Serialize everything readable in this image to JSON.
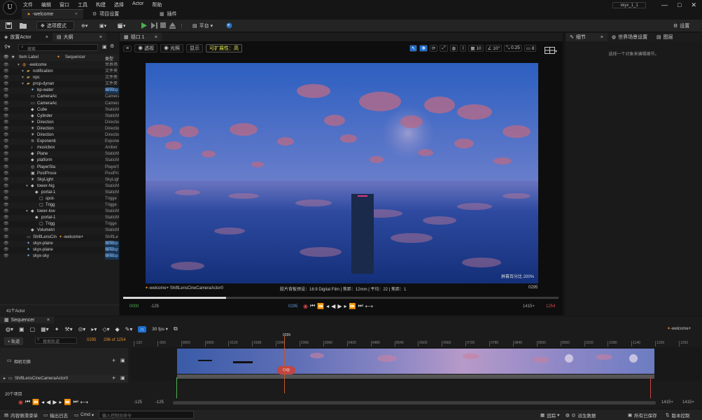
{
  "menubar": {
    "logo": "U",
    "items": [
      "文件",
      "编辑",
      "窗口",
      "工具",
      "构建",
      "选择",
      "Actor",
      "帮助"
    ],
    "window_title": "xkyx_1_1",
    "window_buttons": [
      "—",
      "□",
      "✕"
    ]
  },
  "tabs": {
    "doc": "-welcome",
    "project_settings": "项目设置",
    "plugins": "插件"
  },
  "toolbar": {
    "save_icon": "save-icon",
    "mode": "选项模式",
    "platform": "平台",
    "settings": "设置"
  },
  "outliner": {
    "tab_place": "放置Actor",
    "tab_outliner": "大纲",
    "search_placeholder": "搜索",
    "col_label": "Item Label",
    "col_sequencer": "Sequencer",
    "col_type": "类型",
    "items": [
      {
        "name": "-welcome",
        "type": "世界场",
        "indent": 0,
        "icon": "world"
      },
      {
        "name": "notification",
        "type": "文件夹",
        "indent": 1,
        "icon": "folder"
      },
      {
        "name": "npc",
        "type": "文件夹",
        "indent": 1,
        "icon": "folder"
      },
      {
        "name": "prop-dynan",
        "type": "文件夹",
        "indent": 1,
        "icon": "folder"
      },
      {
        "name": "bp-water",
        "type": "编辑bp",
        "indent": 2,
        "icon": "actor",
        "hl": true
      },
      {
        "name": "CameraAc",
        "type": "Camera",
        "indent": 2,
        "icon": "camera"
      },
      {
        "name": "CameraAc",
        "type": "Camera",
        "indent": 2,
        "icon": "camera"
      },
      {
        "name": "Cube",
        "type": "StaticM",
        "indent": 2,
        "icon": "mesh"
      },
      {
        "name": "Cylinder",
        "type": "StaticM",
        "indent": 2,
        "icon": "mesh"
      },
      {
        "name": "Direction",
        "type": "Direction",
        "indent": 2,
        "icon": "light"
      },
      {
        "name": "Direction",
        "type": "Direction",
        "indent": 2,
        "icon": "light"
      },
      {
        "name": "Direction",
        "type": "Direction",
        "indent": 2,
        "icon": "light"
      },
      {
        "name": "Exponenti",
        "type": "Expone",
        "indent": 2,
        "icon": "fog"
      },
      {
        "name": "musicbox",
        "type": "Amber",
        "indent": 2,
        "icon": "sound"
      },
      {
        "name": "Plane",
        "type": "StaticM",
        "indent": 2,
        "icon": "mesh"
      },
      {
        "name": "platform",
        "type": "StaticM",
        "indent": 2,
        "icon": "mesh"
      },
      {
        "name": "PlayerSta",
        "type": "PlayerS",
        "indent": 2,
        "icon": "player"
      },
      {
        "name": "PostProce",
        "type": "PostPro",
        "indent": 2,
        "icon": "post"
      },
      {
        "name": "SkyLight",
        "type": "SkyLigh",
        "indent": 2,
        "icon": "light"
      },
      {
        "name": "tower-hig",
        "type": "StaticM",
        "indent": 2,
        "icon": "mesh"
      },
      {
        "name": "portal-1",
        "type": "StaticM",
        "indent": 3,
        "icon": "mesh"
      },
      {
        "name": "spot-",
        "type": "Trigge",
        "indent": 4,
        "icon": "trigger"
      },
      {
        "name": "Trigg",
        "type": "Trigge",
        "indent": 4,
        "icon": "trigger"
      },
      {
        "name": "tower-low",
        "type": "StaticM",
        "indent": 2,
        "icon": "mesh"
      },
      {
        "name": "portal-1",
        "type": "StaticM",
        "indent": 3,
        "icon": "mesh"
      },
      {
        "name": "Trigg",
        "type": "Trigge",
        "indent": 4,
        "icon": "trigger"
      },
      {
        "name": "Volumetri",
        "type": "StaticM",
        "indent": 2,
        "icon": "mesh"
      },
      {
        "name": "ShiftLensCin",
        "type": "ShiftLe",
        "indent": 1,
        "icon": "camera",
        "seq": "-welcome+"
      },
      {
        "name": "skyx-plane",
        "type": "编辑bp",
        "indent": 1,
        "icon": "actor",
        "hl": true
      },
      {
        "name": "skyx-plane",
        "type": "编辑bp",
        "indent": 1,
        "icon": "actor",
        "hl": true
      },
      {
        "name": "skyx-sky",
        "type": "编辑bp",
        "indent": 1,
        "icon": "actor",
        "hl": true
      }
    ],
    "count": "41个Actor"
  },
  "viewport": {
    "tab": "视口 1",
    "btn_perspective": "透视",
    "btn_lit": "光照",
    "btn_show": "显示",
    "btn_scalability": "可扩展性：高",
    "snap_angle": "10",
    "snap_rot": "10°",
    "snap_scale": "0.25",
    "cam_speed": "8",
    "screen_percentage": "屏幕百分比 200%",
    "cam_name": "-welcome+ ShiftLensCineCameraActor0",
    "film_info": "胶片背板预设：16:9 Digital Film | 焦距：12mm | 平均：22 | 焦距：1",
    "frame_right": "0295",
    "start_frame": "0000",
    "start_minus": "-125",
    "current": "0295",
    "end_plus": "1415+",
    "end_frame": "1254",
    "play_progress": 0.236
  },
  "details": {
    "tab_details": "细节",
    "tab_world": "世界场景设置",
    "tab_layers": "图层",
    "empty": "选择一个对象来编辑细节。"
  },
  "sequencer": {
    "tab": "Sequencer",
    "fps": "30 fps",
    "seq_name": "-welcome+",
    "add_track": "+ 轨道",
    "search_placeholder": "搜索轨道",
    "current_frame": "0295",
    "frame_counter": "296 of 1254",
    "playhead_label": "0295",
    "ruler": [
      "-120",
      "-060",
      "0000",
      "0060",
      "0120",
      "0180",
      "0240",
      "0300",
      "0360",
      "0420",
      "0480",
      "0540",
      "0600",
      "0660",
      "0720",
      "0780",
      "0840",
      "0900",
      "0960",
      "1020",
      "1080",
      "1140",
      "1200",
      "1260"
    ],
    "track_camera_cut": "相机切换",
    "track_camera_actor": "ShiftLensCineCameraActor0",
    "items_count": "20个项目",
    "left_minus": "-125",
    "left_minus2": "-125",
    "right_plus": "1415+",
    "right_plus2": "1415+"
  },
  "statusbar": {
    "content_drawer": "内容侧滑菜单",
    "output_log": "输出日志",
    "cmd": "Cmd",
    "cmd_placeholder": "输入控制台命令",
    "trace": "追踪",
    "derived_data": "派生数据",
    "save_all": "所有已保存",
    "source_control": "版本控制"
  },
  "colors": {
    "accent_green": "#4caf50",
    "select_blue": "#1f6fd1",
    "playhead": "#c0582a",
    "bg": "#151515"
  }
}
